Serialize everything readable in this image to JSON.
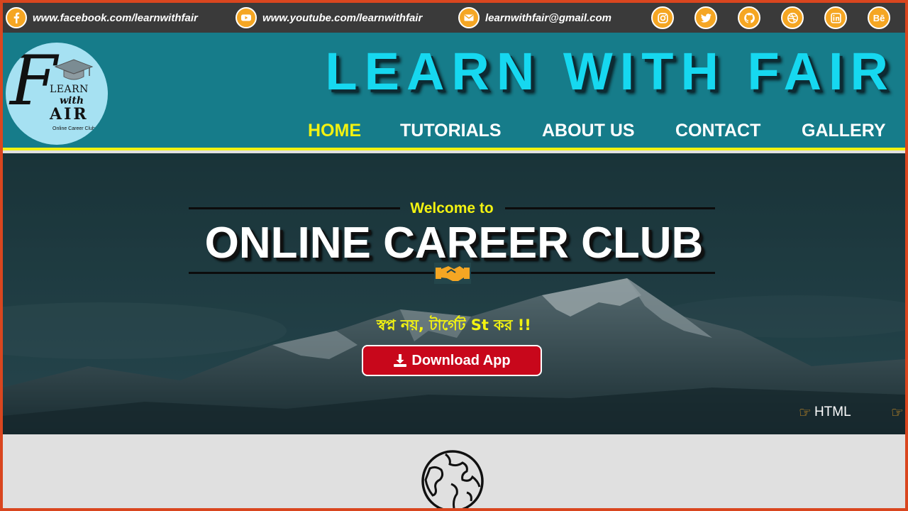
{
  "topbar": {
    "facebook": {
      "icon": "facebook-icon",
      "text": "www.facebook.com/learnwithfair"
    },
    "youtube": {
      "icon": "youtube-icon",
      "text": "www.youtube.com/learnwithfair"
    },
    "email": {
      "icon": "mail-icon",
      "text": "learnwithfair@gmail.com"
    },
    "socials": [
      "instagram-icon",
      "twitter-icon",
      "github-icon",
      "dribbble-icon",
      "linkedin-icon",
      "behance-icon"
    ],
    "behance_text": "Bē",
    "accent": "#f5a623",
    "bg": "#3a3a3a"
  },
  "header": {
    "title": "LEARN WITH FAIR",
    "logo": {
      "f": "F",
      "learn": "LEARN",
      "with": "with",
      "air": "AIR",
      "sub": "Online Career Club"
    },
    "nav": [
      {
        "label": "HOME",
        "active": true
      },
      {
        "label": "TUTORIALS",
        "active": false
      },
      {
        "label": "ABOUT US",
        "active": false
      },
      {
        "label": "CONTACT",
        "active": false
      },
      {
        "label": "GALLERY",
        "active": false
      }
    ],
    "bg": "#167c8a",
    "title_color": "#16d8f0",
    "active_color": "#f2f211"
  },
  "hero": {
    "welcome": "Welcome to",
    "title": "ONLINE CAREER CLUB",
    "tagline": "স্বপ্ন নয়, টার্গেট St কর !!",
    "download_label": "Download App",
    "ticker": [
      "HTML"
    ],
    "button_color": "#c8071b"
  }
}
